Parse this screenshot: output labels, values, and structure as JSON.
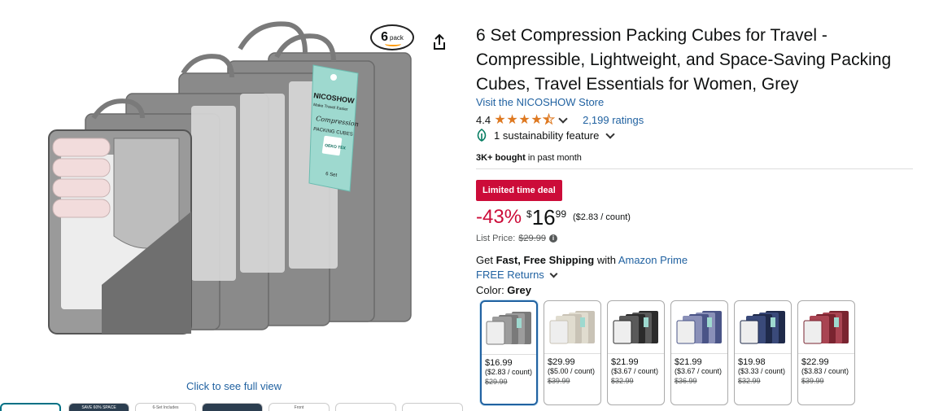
{
  "product": {
    "title": "6 Set Compression Packing Cubes for Travel - Compressible, Lightweight, and Space-Saving Packing Cubes, Travel Essentials for Women, Grey",
    "store_link": "Visit the NICOSHOW Store",
    "rating_value": "4.4",
    "rating_stars": 4.4,
    "ratings_count": "2,199 ratings",
    "sustainability": "1 sustainability feature",
    "bought_bold": "3K+ bought",
    "bought_rest": " in past month"
  },
  "image": {
    "pack_badge_number": "6",
    "pack_badge_word": "pack",
    "brand_tag": "NICOSHOW",
    "tag_slogan": "Make Travel Easier",
    "tag_script": "Compression",
    "tag_sub": "PACKING CUBES",
    "tag_cert": "OEKO TEX",
    "tag_count": "6 Set",
    "see_full": "Click to see full view",
    "thumb_labels": [
      "",
      "SAVE 60% SPACE",
      "6-Set Includes",
      "",
      "Front",
      "",
      ""
    ]
  },
  "pricing": {
    "deal_badge": "Limited time deal",
    "discount": "-43%",
    "currency": "$",
    "whole": "16",
    "fraction": "99",
    "unit_price": "($2.83 / count)",
    "list_price_label": "List Price:",
    "list_price": "$29.99",
    "info_glyph": "i"
  },
  "shipping": {
    "prefix": "Get ",
    "bold": "Fast, Free Shipping",
    "middle": " with ",
    "prime_link": "Amazon Prime",
    "returns": "FREE Returns"
  },
  "color": {
    "label": "Color: ",
    "selected": "Grey"
  },
  "swatches": [
    {
      "price": "$16.99",
      "unit": "($2.83 / count)",
      "was": "$29.99",
      "color": "#7a7a7a",
      "accent": "#9c9c9c"
    },
    {
      "price": "$29.99",
      "unit": "($5.00 / count)",
      "was": "$39.99",
      "color": "#c9c3b6",
      "accent": "#e0dccf"
    },
    {
      "price": "$21.99",
      "unit": "($3.67 / count)",
      "was": "$32.99",
      "color": "#2b2b2b",
      "accent": "#5a5a5a"
    },
    {
      "price": "$21.99",
      "unit": "($3.67 / count)",
      "was": "$36.99",
      "color": "#4a5487",
      "accent": "#8a90b8"
    },
    {
      "price": "$19.98",
      "unit": "($3.33 / count)",
      "was": "$32.99",
      "color": "#1f2a4a",
      "accent": "#3a4a7a"
    },
    {
      "price": "$22.99",
      "unit": "($3.83 / count)",
      "was": "$39.99",
      "color": "#7a2430",
      "accent": "#a94452"
    }
  ],
  "colors": {
    "link": "#2162a1",
    "deal_red": "#cc0c39",
    "star": "#de7921"
  }
}
